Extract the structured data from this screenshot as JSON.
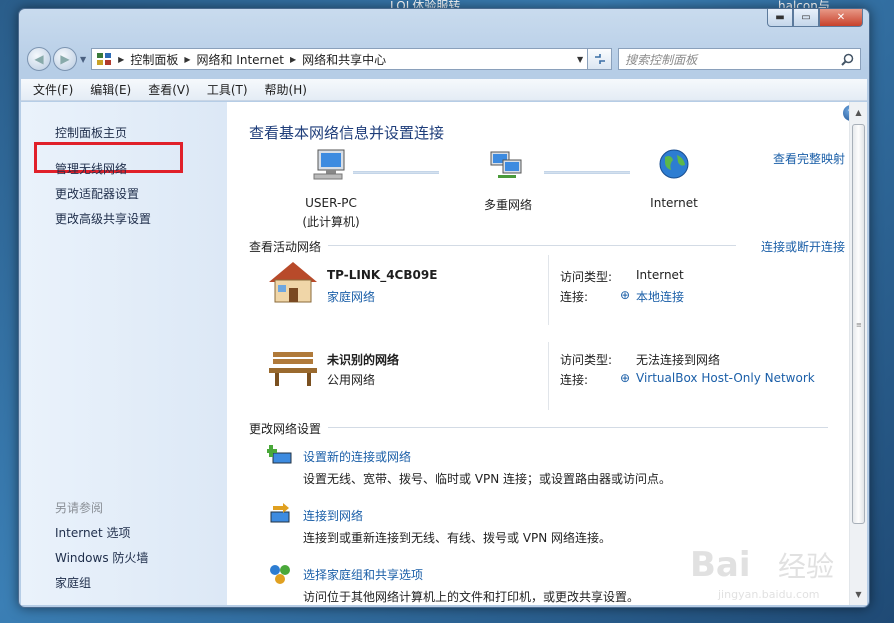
{
  "desktop": {
    "left_text": "LOL体验服转",
    "right_text": "halcon与"
  },
  "caption_buttons": {
    "minimize": "▬",
    "maximize": "▭",
    "close": "✕"
  },
  "address": {
    "crumbs": [
      "控制面板",
      "网络和 Internet",
      "网络和共享中心"
    ],
    "search_placeholder": "搜索控制面板"
  },
  "menu": [
    "文件(F)",
    "编辑(E)",
    "查看(V)",
    "工具(T)",
    "帮助(H)"
  ],
  "sidebar": {
    "home": "控制面板主页",
    "links": [
      "管理无线网络",
      "更改适配器设置",
      "更改高级共享设置"
    ],
    "see_also_header": "另请参阅",
    "see_also": [
      "Internet 选项",
      "Windows 防火墙",
      "家庭组"
    ]
  },
  "main": {
    "title": "查看基本网络信息并设置连接",
    "view_full_map": "查看完整映射",
    "nodes": {
      "pc_line1": "USER-PC",
      "pc_line2": "(此计算机)",
      "multi": "多重网络",
      "internet": "Internet"
    },
    "active_header": "查看活动网络",
    "connect_disconnect": "连接或断开连接",
    "networks": [
      {
        "name": "TP-LINK_4CB09E",
        "category": "家庭网络",
        "access_label": "访问类型:",
        "access_value": "Internet",
        "conn_label": "连接:",
        "conn_value": "本地连接"
      },
      {
        "name": "未识别的网络",
        "category": "公用网络",
        "access_label": "访问类型:",
        "access_value": "无法连接到网络",
        "conn_label": "连接:",
        "conn_value": "VirtualBox Host-Only Network"
      }
    ],
    "change_header": "更改网络设置",
    "tasks": [
      {
        "title": "设置新的连接或网络",
        "desc": "设置无线、宽带、拨号、临时或 VPN 连接；或设置路由器或访问点。"
      },
      {
        "title": "连接到网络",
        "desc": "连接到或重新连接到无线、有线、拨号或 VPN 网络连接。"
      },
      {
        "title": "选择家庭组和共享选项",
        "desc": "访问位于其他网络计算机上的文件和打印机，或更改共享设置。"
      }
    ]
  },
  "watermark": {
    "brand": "Bai",
    "brand2": "经验",
    "url": "jingyan.baidu.com"
  },
  "colors": {
    "accent": "#1b5fa8",
    "highlight_box": "#e0202a"
  }
}
